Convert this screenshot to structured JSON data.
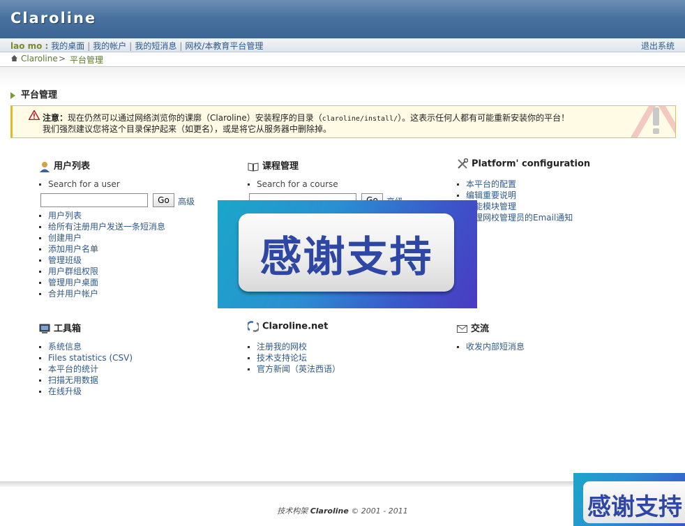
{
  "header": {
    "logo": "Claroline"
  },
  "userbar": {
    "user": "lao mo :",
    "links": [
      "我的桌面",
      "我的帐户",
      "我的短消息",
      "网校/本教育平台管理"
    ],
    "logout": "退出系统"
  },
  "breadcrumb": {
    "home": "Claroline",
    "sep": ">",
    "current": "平台管理"
  },
  "page_title": "平台管理",
  "warning": {
    "label": "注意：",
    "line1_a": "现在仍然可以通过网络浏览你的课廓（Claroline）安装程序的目录（",
    "line1_path": "claroline/install/",
    "line1_b": "）。这表示任何人都有可能重新安装你的平台！",
    "line2": "我们强烈建议您将这个目录保护起来（如更名），或是将它从服务器中删除掉。"
  },
  "sections": {
    "users": {
      "title": "用户列表",
      "search_label": "Search for a user",
      "go": "Go",
      "advanced": "高级",
      "items": [
        "用户列表",
        "给所有注册用户发送一条短消息",
        "创建用户",
        "添加用户名单",
        "管理班级",
        "用户群组权限",
        "管理用户桌面",
        "合并用户帐户"
      ]
    },
    "courses": {
      "title": "课程管理",
      "search_label": "Search for a course",
      "go": "Go",
      "advanced": "高级"
    },
    "config": {
      "title": "Platform' configuration",
      "items": [
        "本平台的配置",
        "编辑重要说明",
        "功能模块管理",
        "管理网校管理员的Email通知"
      ]
    },
    "tools": {
      "title": "工具箱",
      "items": [
        "系统信息",
        "Files statistics (CSV)",
        "本平台的统计",
        "扫描无用数据",
        "在线升级"
      ]
    },
    "claronet": {
      "title": "Claroline.net",
      "items": [
        "注册我的网校",
        "技术支持论坛",
        "官方新闻（英法西语）"
      ]
    },
    "comm": {
      "title": "交流",
      "items": [
        "收发内部短消息"
      ]
    }
  },
  "footer": {
    "prefix": "技术构架",
    "brand": "Claroline",
    "suffix": "© 2001 - 2011"
  },
  "promo": {
    "text": "感谢支持",
    "text_partial": "感谢支持"
  }
}
